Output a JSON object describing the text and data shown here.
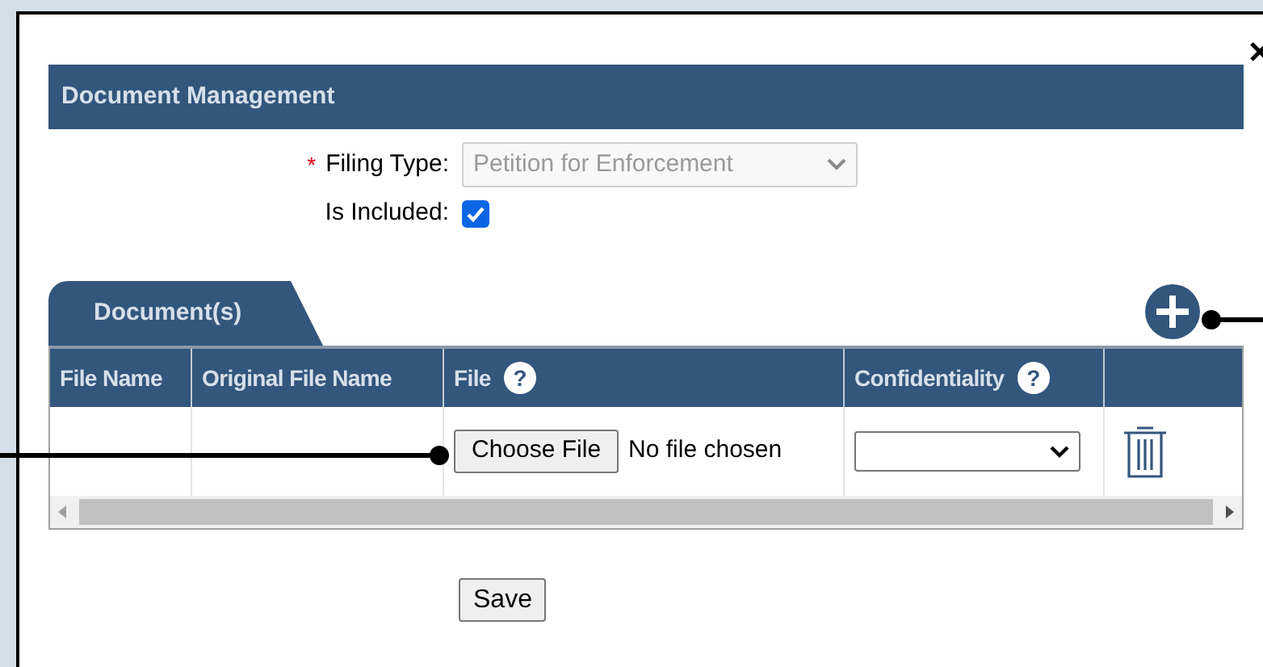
{
  "dialog": {
    "title": "Document Management"
  },
  "filing_type": {
    "label": "Filing Type:",
    "required_mark": "*",
    "value": "Petition for Enforcement",
    "disabled": true
  },
  "is_included": {
    "label": "Is Included:",
    "checked": true
  },
  "tabs": [
    {
      "label": "Document(s)",
      "selected": true
    }
  ],
  "table": {
    "columns": [
      {
        "label": "File Name"
      },
      {
        "label": "Original File Name"
      },
      {
        "label": "File",
        "help_icon": "?"
      },
      {
        "label": "Confidentiality",
        "help_icon": "?"
      }
    ],
    "rows": [
      {
        "choose_button": "Choose File",
        "file_status": "No file chosen"
      }
    ]
  },
  "save_button": "Save"
}
